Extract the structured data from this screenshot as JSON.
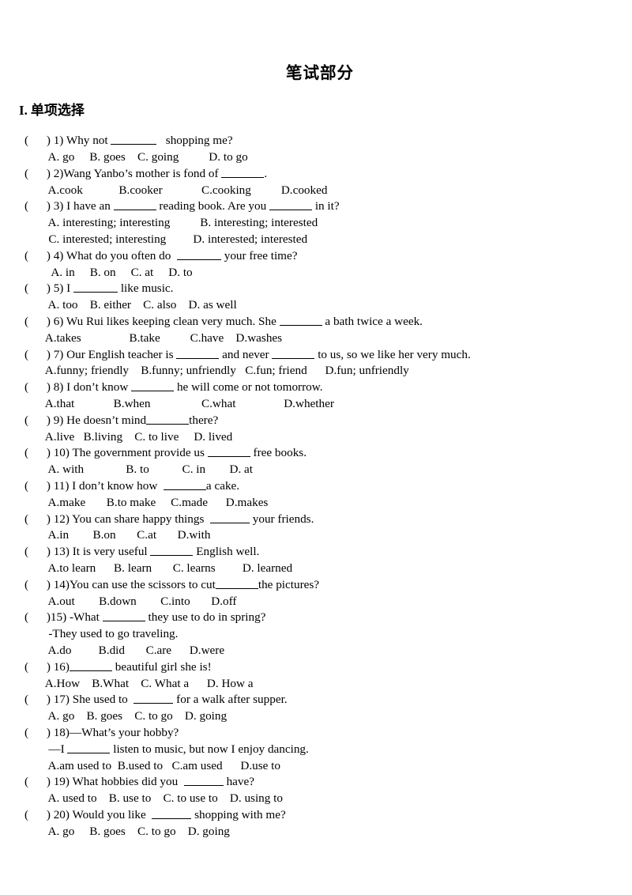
{
  "document": {
    "title": "笔试部分",
    "section": {
      "number": "I.",
      "label": "单项选择"
    }
  },
  "questions": [
    {
      "num": "1)",
      "stem_before": " 1) Why not ",
      "blank_width": 58,
      "stem_after": "   shopping me?",
      "options_line": "  A. go     B. goes    C. going          D. to go"
    },
    {
      "num": "2)",
      "stem_before": " 2)Wang Yanbo’s mother is fond of ",
      "blank_width": 54,
      "stem_after": ".",
      "options_line": "  A.cook            B.cooker             C.cooking          D.cooked"
    },
    {
      "num": "3)",
      "stem_before": " 3) I have an ",
      "blank_width": 54,
      "stem_mid": " reading book. Are you ",
      "blank2_width": 54,
      "stem_after": " in it?",
      "options_line_1": "  A. interesting; interesting          B. interesting; interested",
      "options_line_2": "  C. interested; interesting         D. interested; interested"
    },
    {
      "num": "4)",
      "stem_before": " 4) What do you often do  ",
      "blank_width": 56,
      "stem_after": " your free time?",
      "options_line": "   A. in     B. on     C. at     D. to"
    },
    {
      "num": "5)",
      "stem_before": " 5) I ",
      "blank_width": 56,
      "stem_after": " like music.",
      "options_line": "  A. too    B. either    C. also    D. as well"
    },
    {
      "num": "6)",
      "stem_before": " 6) Wu Rui likes keeping clean very much. She ",
      "blank_width": 54,
      "stem_after": " a bath twice a week.",
      "options_line": " A.takes                B.take          C.have    D.washes"
    },
    {
      "num": "7)",
      "stem_before": " 7) Our English teacher is ",
      "blank_width": 54,
      "stem_mid": " and never ",
      "blank2_width": 54,
      "stem_after": " to us, so we like her very much.",
      "options_line": " A.funny; friendly    B.funny; unfriendly   C.fun; friend      D.fun; unfriendly"
    },
    {
      "num": "8)",
      "stem_before": " 8) I don’t know ",
      "blank_width": 54,
      "stem_after": " he will come or not tomorrow.",
      "options_line": " A.that             B.when                 C.what                D.whether"
    },
    {
      "num": "9)",
      "stem_before": " 9) He doesn’t mind",
      "blank_width": 54,
      "stem_after": "there?",
      "options_line": " A.live   B.living    C. to live     D. lived"
    },
    {
      "num": "10)",
      "stem_before": " 10) The government provide us ",
      "blank_width": 54,
      "stem_after": " free books.",
      "options_line": "  A. with              B. to           C. in        D. at"
    },
    {
      "num": "11)",
      "stem_before": " 11) I don’t know how  ",
      "blank_width": 54,
      "stem_after": "a cake.",
      "options_line": "  A.make       B.to make     C.made      D.makes"
    },
    {
      "num": "12)",
      "stem_before": " 12) You can share happy things  ",
      "blank_width": 50,
      "stem_after": " your friends.",
      "options_line": "  A.in        B.on       C.at       D.with"
    },
    {
      "num": "13)",
      "stem_before": " 13) It is very useful ",
      "blank_width": 54,
      "stem_after": " English well.",
      "options_line": "  A.to learn      B. learn       C. learns         D. learned"
    },
    {
      "num": "14)",
      "stem_before": " 14)You can use the scissors to cut",
      "blank_width": 54,
      "stem_after": "the pictures?",
      "options_line": "  A.out        B.down        C.into       D.off"
    },
    {
      "num": "15)",
      "stem_before": ")15) -What ",
      "blank_width": 54,
      "stem_after": " they use to do in spring?",
      "sub_line": "  -They used to go traveling.",
      "options_line": "  A.do         B.did       C.are      D.were"
    },
    {
      "num": "16)",
      "stem_before": " 16)",
      "blank_width": 54,
      "stem_after": " beautiful girl she is!",
      "options_line": " A.How    B.What    C. What a      D. How a"
    },
    {
      "num": "17)",
      "stem_before": " 17) She used to  ",
      "blank_width": 50,
      "stem_after": " for a walk after supper.",
      "options_line": "  A. go    B. goes    C. to go    D. going"
    },
    {
      "num": "18)",
      "stem_before": " 18)—What’s your hobby?",
      "blank_width": 0,
      "stem_after": "",
      "sub_line": "  —I ",
      "sub_blank_width": 54,
      "sub_after": " listen to music, but now I enjoy dancing.",
      "options_line": "  A.am used to  B.used to   C.am used      D.use to"
    },
    {
      "num": "19)",
      "stem_before": " 19) What hobbies did you  ",
      "blank_width": 50,
      "stem_after": " have?",
      "options_line": "  A. used to    B. use to    C. to use to    D. using to"
    },
    {
      "num": "20)",
      "stem_before": " 20) Would you like  ",
      "blank_width": 50,
      "stem_after": " shopping with me?",
      "options_line": "  A. go     B. goes    C. to go    D. going"
    }
  ],
  "marker": {
    "open": "(",
    "gap": "      ",
    "close": ")"
  }
}
